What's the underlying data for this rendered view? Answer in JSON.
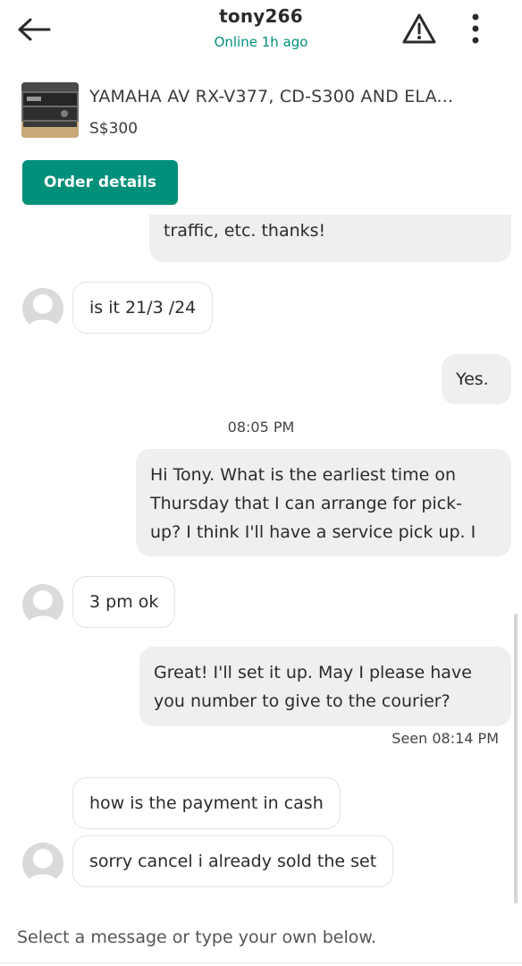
{
  "header": {
    "title": "tony266",
    "status": "Online 1h ago",
    "icons": {
      "back": "arrow-left-icon",
      "report": "warning-triangle-icon",
      "more": "vertical-dots-icon"
    }
  },
  "listing": {
    "title": "YAMAHA AV RX-V377, CD-S300 AND ELA...",
    "price": "S$300"
  },
  "order_button": "Order details",
  "messages": {
    "m1": "traffic, etc. thanks!",
    "m2": "is it 21/3 /24",
    "m3": "Yes.",
    "time1": "08:05 PM",
    "m4": [
      "Hi Tony. What is the earliest time on",
      "Thursday that I can arrange for pick-",
      "up? I think I'll have a service pick up. I"
    ],
    "m5": "3 pm ok",
    "m6": [
      "Great! I'll set it up. May I please have",
      "you number to give to the courier?"
    ],
    "seen": "Seen 08:14 PM",
    "m7": "how is the payment in cash",
    "m8": "sorry cancel i already sold the set"
  },
  "input": {
    "placeholder": "Select a message or type your own below."
  },
  "colors": {
    "accent": "#008f79",
    "outgoing_bubble": "#efefef",
    "incoming_border": "#e3e3e3"
  }
}
